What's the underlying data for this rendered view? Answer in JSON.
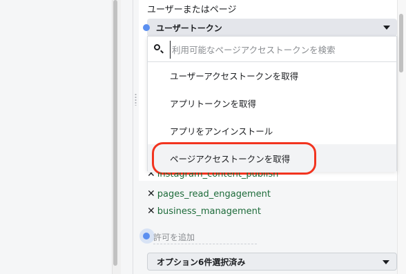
{
  "token_section": {
    "label": "ユーザーまたはページ",
    "selected": "ユーザートークン"
  },
  "dropdown": {
    "search_placeholder": "利用可能なページアクセストークンを検索",
    "items": [
      {
        "label": "ユーザーアクセストークンを取得"
      },
      {
        "label": "アプリトークンを取得"
      },
      {
        "label": "アプリをアンインストール"
      },
      {
        "label": "ページアクセストークンを取得"
      }
    ]
  },
  "permissions": {
    "remove_symbol": "✕",
    "items": [
      {
        "label": "instagram_content_publish"
      },
      {
        "label": "pages_read_engagement"
      },
      {
        "label": "business_management"
      }
    ],
    "add_placeholder": "許可を追加"
  },
  "options": {
    "label": "オプション6件選択済み"
  },
  "colors": {
    "highlight": "#f2341f",
    "permission_text": "#1d6b3a",
    "dot": "#5b8ff0"
  },
  "icons": [
    "search-icon",
    "chevron-down-icon",
    "remove-icon",
    "resize-handle-icon"
  ]
}
